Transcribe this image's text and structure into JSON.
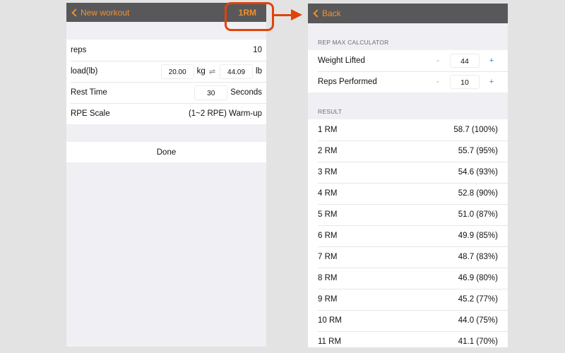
{
  "left": {
    "nav": {
      "back_label": "New workout",
      "right_label": "1RM"
    },
    "rows": {
      "reps": {
        "label": "reps",
        "value": "10"
      },
      "load": {
        "label": "load(lb)",
        "kg_value": "20.00",
        "kg_unit": "kg",
        "swap_glyph": "⇌",
        "lb_value": "44.09",
        "lb_unit": "lb"
      },
      "rest": {
        "label": "Rest Time",
        "value": "30",
        "unit": "Seconds"
      },
      "rpe": {
        "label": "RPE Scale",
        "value": "(1~2 RPE) Warm-up"
      }
    },
    "done_label": "Done"
  },
  "right": {
    "nav": {
      "back_label": "Back"
    },
    "calculator": {
      "header": "REP MAX CALCULATOR",
      "weight": {
        "label": "Weight Lifted",
        "value": "44",
        "minus": "-",
        "plus": "+"
      },
      "reps": {
        "label": "Reps Performed",
        "value": "10",
        "minus": "-",
        "plus": "+"
      }
    },
    "result": {
      "header": "RESULT",
      "rows": [
        {
          "label": "1 RM",
          "value": "58.7 (100%)"
        },
        {
          "label": "2 RM",
          "value": "55.7 (95%)"
        },
        {
          "label": "3 RM",
          "value": "54.6 (93%)"
        },
        {
          "label": "4 RM",
          "value": "52.8 (90%)"
        },
        {
          "label": "5 RM",
          "value": "51.0 (87%)"
        },
        {
          "label": "6 RM",
          "value": "49.9 (85%)"
        },
        {
          "label": "7 RM",
          "value": "48.7 (83%)"
        },
        {
          "label": "8 RM",
          "value": "46.9 (80%)"
        },
        {
          "label": "9 RM",
          "value": "45.2 (77%)"
        },
        {
          "label": "10 RM",
          "value": "44.0 (75%)"
        },
        {
          "label": "11 RM",
          "value": "41.1 (70%)"
        }
      ]
    }
  },
  "colors": {
    "accent": "#f0922b",
    "navbar": "#58585a",
    "annotation": "#e0430a",
    "stepper_plus": "#3a7fd5"
  }
}
